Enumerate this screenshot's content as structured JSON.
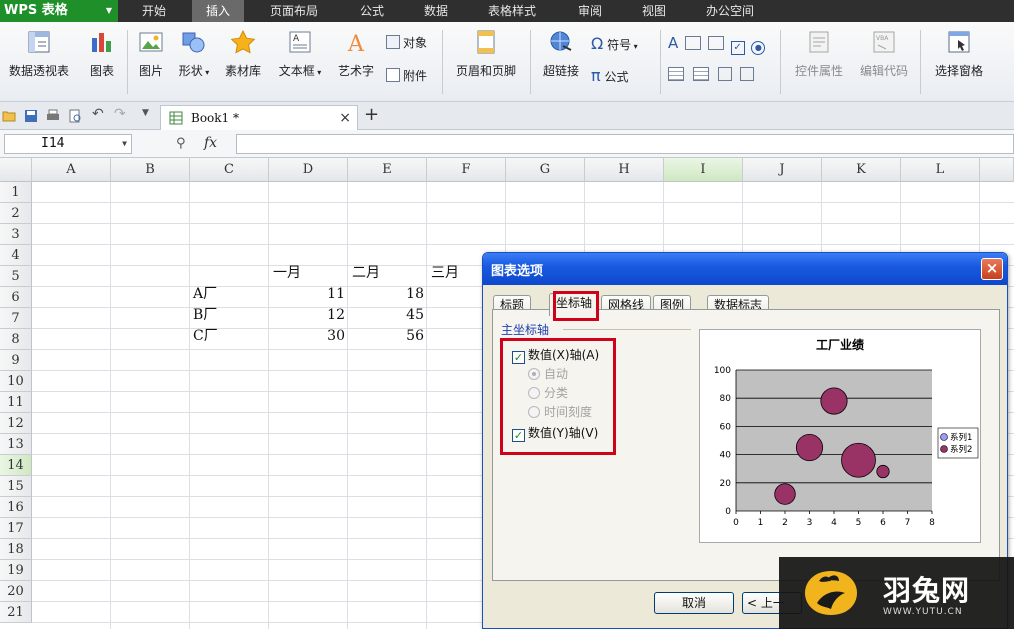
{
  "app": {
    "name": "WPS 表格"
  },
  "menu": {
    "tabs": [
      "开始",
      "插入",
      "页面布局",
      "公式",
      "数据",
      "表格样式",
      "审阅",
      "视图",
      "办公空间"
    ],
    "active": "插入"
  },
  "ribbon": {
    "pivot": "数据透视表",
    "chart": "图表",
    "picture": "图片",
    "shapes": "形状",
    "material": "素材库",
    "textbox": "文本框",
    "wordart": "艺术字",
    "object": "对象",
    "attachment": "附件",
    "header_footer": "页眉和页脚",
    "hyperlink": "超链接",
    "symbol": "符号",
    "formula": "公式",
    "control_props": "控件属性",
    "edit_code": "编辑代码",
    "select_pane": "选择窗格"
  },
  "doc_tab": {
    "title": "Book1 *",
    "close": "×",
    "add": "+"
  },
  "formula_bar": {
    "name_box": "I14",
    "fx": "fx",
    "value": ""
  },
  "sheet": {
    "columns": [
      "A",
      "B",
      "C",
      "D",
      "E",
      "F",
      "G",
      "H",
      "I",
      "J",
      "K",
      "L"
    ],
    "selected_col": "I",
    "selected_row": 14,
    "rows": [
      "1",
      "2",
      "3",
      "4",
      "5",
      "6",
      "7",
      "8",
      "9",
      "10",
      "11",
      "12",
      "13",
      "14",
      "15",
      "16",
      "17",
      "18",
      "19",
      "20",
      "21"
    ],
    "cells": {
      "d5": "一月",
      "e5": "二月",
      "f5": "三月",
      "c6": "A厂",
      "d6": "11",
      "e6": "18",
      "c7": "B厂",
      "d7": "12",
      "e7": "45",
      "c8": "C厂",
      "d8": "30",
      "e8": "56"
    }
  },
  "dialog": {
    "title": "图表选项",
    "tabs": [
      "标题",
      "坐标轴",
      "网格线",
      "图例",
      "数据标志"
    ],
    "active_tab": "坐标轴",
    "group_label": "主坐标轴",
    "x_axis": {
      "label": "数值(X)轴(A)",
      "checked": true
    },
    "x_options": [
      {
        "label": "自动",
        "selected": true
      },
      {
        "label": "分类",
        "selected": false
      },
      {
        "label": "时间刻度",
        "selected": false
      }
    ],
    "y_axis": {
      "label": "数值(Y)轴(V)",
      "checked": true
    },
    "buttons": {
      "cancel": "取消",
      "prev": "< 上一"
    },
    "colors": {
      "plot_bg": "#c0c0c0",
      "bubble1": "#993366",
      "bubble2": "#993366",
      "highlight": "#d0021b"
    }
  },
  "chart_data": {
    "type": "scatter",
    "title": "工厂业绩",
    "xlim": [
      0,
      8
    ],
    "ylim": [
      0,
      100
    ],
    "x_ticks": [
      "0",
      "1",
      "2",
      "3",
      "4",
      "5",
      "6",
      "7",
      "8"
    ],
    "y_ticks": [
      "0",
      "20",
      "40",
      "60",
      "80",
      "100"
    ],
    "grid": true,
    "legend_position": "right",
    "series": [
      {
        "name": "系列1",
        "points": []
      },
      {
        "name": "系列2",
        "points": [
          {
            "x": 2,
            "y": 12,
            "size": 11
          },
          {
            "x": 3,
            "y": 45,
            "size": 18
          },
          {
            "x": 4,
            "y": 78,
            "size": 18
          },
          {
            "x": 5,
            "y": 36,
            "size": 30
          },
          {
            "x": 6,
            "y": 28,
            "size": 4
          }
        ]
      }
    ]
  },
  "watermark": {
    "name": "羽兔网",
    "url": "WWW.YUTU.CN"
  }
}
